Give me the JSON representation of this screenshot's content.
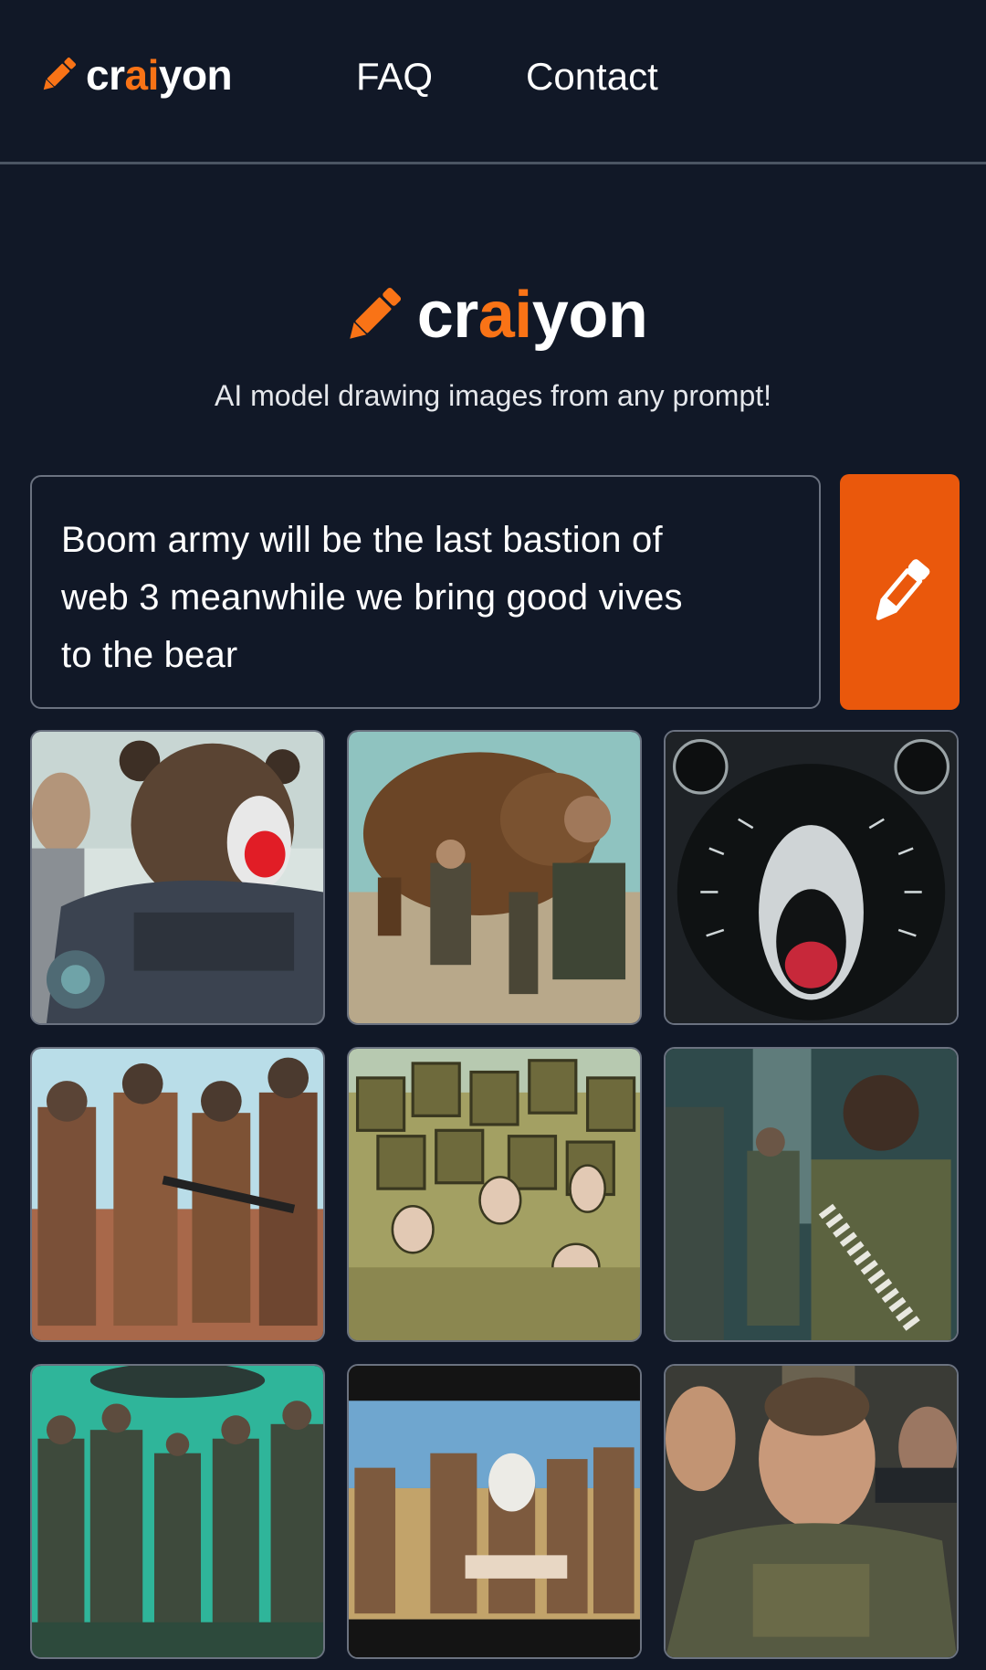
{
  "nav": {
    "logo_prefix": "cr",
    "logo_accent": "ai",
    "logo_suffix": "yon",
    "links": [
      "FAQ",
      "Contact"
    ]
  },
  "hero": {
    "logo_prefix": "cr",
    "logo_accent": "ai",
    "logo_suffix": "yon",
    "tagline": "AI model drawing images from any prompt!"
  },
  "prompt": {
    "lines": [
      "Boom army will be the last bastion of",
      "web 3 meanwhile we bring good vives",
      "to the bear"
    ],
    "draw_icon": "crayon-icon"
  },
  "images": [
    {
      "name": "armored-bear-soldier-cartoon-image"
    },
    {
      "name": "brown-bear-and-soldiers-field-image"
    },
    {
      "name": "roaring-black-bear-image"
    },
    {
      "name": "soldiers-walking-desert-image"
    },
    {
      "name": "soldier-crowd-illustration-image"
    },
    {
      "name": "soldier-in-hallway-image"
    },
    {
      "name": "green-tinted-soldiers-image"
    },
    {
      "name": "painted-soldiers-group-image"
    },
    {
      "name": "soldier-portrait-image"
    }
  ],
  "colors": {
    "background": "#111827",
    "accent": "#f97316",
    "button": "#ea580c",
    "border": "#6b7280"
  }
}
